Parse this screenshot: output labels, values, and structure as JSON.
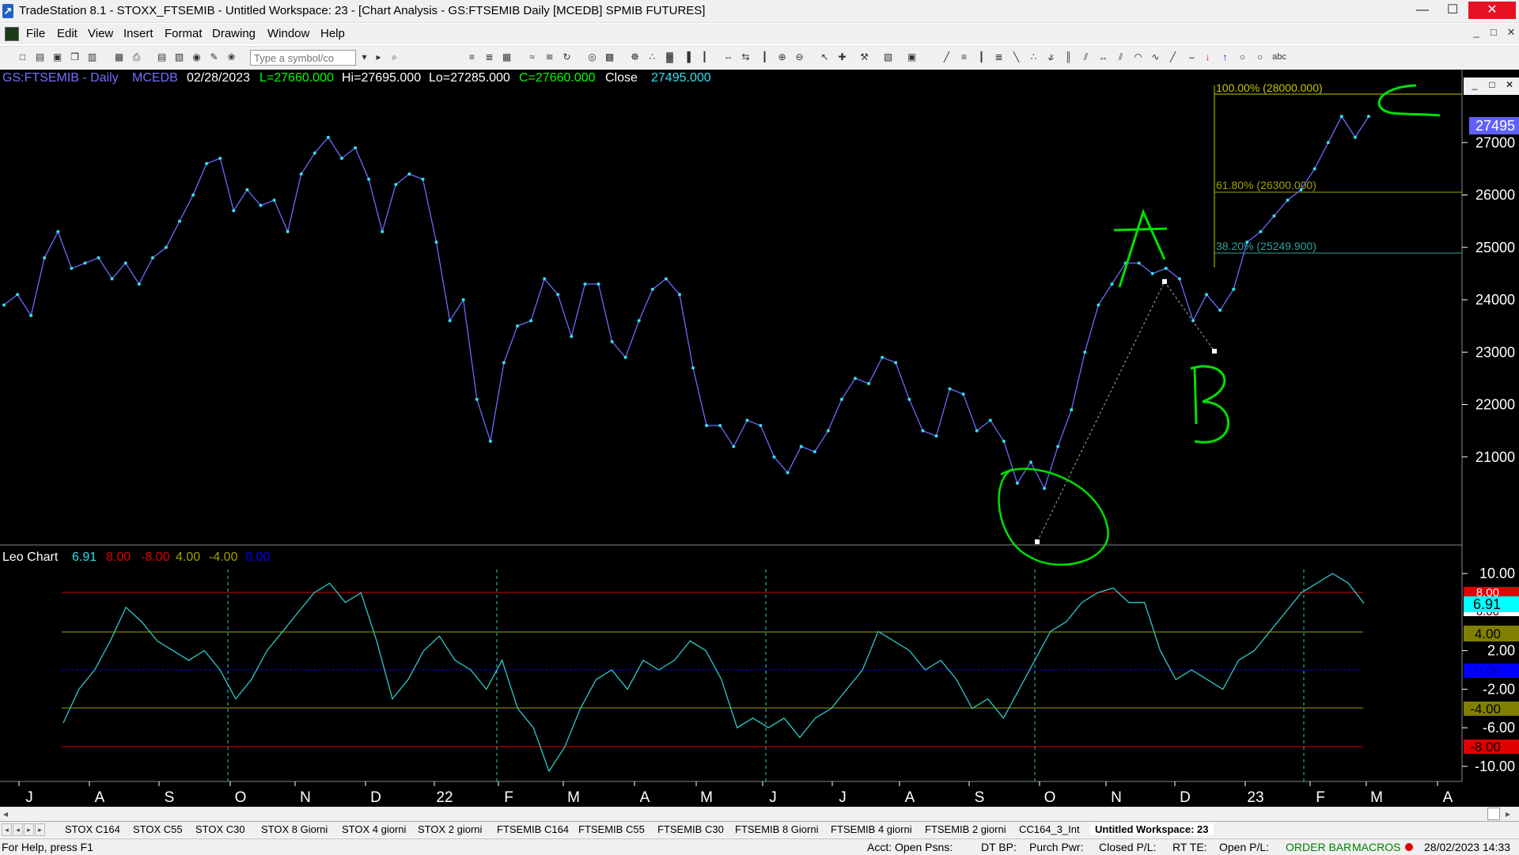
{
  "window": {
    "title": "TradeStation 8.1 - STOXX_FTSEMIB - Untitled Workspace:  23 - [Chart Analysis - GS:FTSEMIB  Daily  [MCEDB] SPMIB FUTURES]",
    "minimize": "—",
    "maximize": "☐",
    "close": "✕"
  },
  "menu": {
    "items": [
      "File",
      "Edit",
      "View",
      "Insert",
      "Format",
      "Drawing",
      "Window",
      "Help"
    ],
    "mdi": [
      "_",
      "□",
      "✕"
    ]
  },
  "toolbar": {
    "symbol_placeholder": "Type a symbol/co"
  },
  "chart_header": {
    "symbol": "GS:FTSEMIB - Daily",
    "source": "MCEDB",
    "date": "02/28/2023",
    "low": "L=27660.000",
    "high": "Hi=27695.000",
    "lo": "Lo=27285.000",
    "close": "C=27660.000",
    "close_label": "Close",
    "close_value": "27495.000"
  },
  "price_axis": {
    "ticks": [
      "27000",
      "26000",
      "25000",
      "24000",
      "23000",
      "22000",
      "21000"
    ],
    "current": "27495"
  },
  "fib": {
    "l100": "100.00% (28000.000)",
    "l618": "61.80% (26300.000)",
    "l382": "38.20% (25249.900)"
  },
  "annotations": {
    "a": "A",
    "b": "B",
    "c": "C"
  },
  "indicator": {
    "name": "Leo Chart",
    "v1": "6.91",
    "v2": "8.00",
    "v3": "-8.00",
    "v4": "4.00",
    "v5": "-4.00",
    "v6": "0.00",
    "axis": [
      "10.00",
      "2.00",
      "-2.00",
      "-6.00",
      "-10.00"
    ],
    "boxes": [
      "8.00",
      "6.91",
      "6.00",
      "4.00",
      "0.00",
      "-4.00",
      "-8.00"
    ]
  },
  "time_axis": [
    "J",
    "A",
    "S",
    "O",
    "N",
    "D",
    "22",
    "F",
    "M",
    "A",
    "M",
    "J",
    "J",
    "A",
    "S",
    "O",
    "N",
    "D",
    "23",
    "F",
    "M",
    "A"
  ],
  "tabs": [
    "STOX C164",
    "STOX C55",
    "STOX  C30",
    "STOX  8 Giorni",
    "STOX 4 giorni",
    "STOX  2 giorni",
    "FTSEMIB C164",
    "FTSEMIB C55",
    "FTSEMIB C30",
    "FTSEMIB  8 Giorni",
    "FTSEMIB  4 giorni",
    "FTSEMIB  2 giorni",
    "CC164_3_Int",
    "Untitled Workspace:  23"
  ],
  "status": {
    "help": "For Help, press F1",
    "acct": "Acct:",
    "open_psns": "Open Psns:",
    "dt_bp": "DT BP:",
    "purch_pwr": "Purch Pwr:",
    "closed_pl": "Closed P/L:",
    "rt_te": "RT TE:",
    "open_pl": "Open P/L:",
    "order_bar": "ORDER BAR",
    "macros": "MACROS",
    "datetime": "28/02/2023 14:33"
  },
  "colors": {
    "price_line": "#6a6aff",
    "price_dot": "#30e0f0",
    "indicator_line": "#30c8c8",
    "level_red": "#e00000",
    "level_olive": "#a0a000",
    "level_blue": "#0000ff",
    "annotation": "#00e000",
    "fib_100": "#c8c800",
    "fib_618": "#a0a000",
    "fib_382": "#30a0a0"
  },
  "chart_data": [
    {
      "type": "line",
      "title": "GS:FTSEMIB - Daily",
      "x_labels": [
        "J",
        "A",
        "S",
        "O",
        "N",
        "D",
        "22",
        "F",
        "M",
        "A",
        "M",
        "J",
        "J",
        "A",
        "S",
        "O",
        "N",
        "D",
        "23",
        "F"
      ],
      "y": [
        23900,
        24100,
        23700,
        24800,
        25300,
        24600,
        24700,
        24800,
        24400,
        24700,
        24300,
        24800,
        25000,
        25500,
        26000,
        26600,
        26700,
        25700,
        26100,
        25800,
        25900,
        25300,
        26400,
        26800,
        27100,
        26700,
        26900,
        26300,
        25300,
        26200,
        26400,
        26300,
        25100,
        23600,
        24000,
        22100,
        21300,
        22800,
        23500,
        23600,
        24400,
        24100,
        23300,
        24300,
        24300,
        23200,
        22900,
        23600,
        24200,
        24400,
        24100,
        22700,
        21600,
        21600,
        21200,
        21700,
        21600,
        21000,
        20700,
        21200,
        21100,
        21500,
        22100,
        22500,
        22400,
        22900,
        22800,
        22100,
        21500,
        21400,
        22300,
        22200,
        21500,
        21700,
        21300,
        20500,
        20900,
        20400,
        21200,
        21900,
        23000,
        23900,
        24300,
        24700,
        24700,
        24500,
        24600,
        24400,
        23600,
        24100,
        23800,
        24200,
        25100,
        25300,
        25600,
        25900,
        26100,
        26500,
        27000,
        27500,
        27100,
        27500
      ],
      "ylim": [
        20000,
        28000
      ]
    },
    {
      "type": "line",
      "title": "Leo Chart",
      "y": [
        -5.5,
        -2,
        0,
        3,
        6.5,
        5,
        3,
        2,
        1,
        2,
        0,
        -3,
        -1,
        2,
        4,
        6,
        8,
        9,
        7,
        8,
        3,
        -3,
        -1,
        2,
        3.5,
        1,
        0,
        -2,
        1,
        -4,
        -6,
        -10.5,
        -8,
        -4,
        -1,
        0,
        -2,
        1,
        0,
        1,
        3,
        2,
        -1,
        -6,
        -5,
        -6,
        -5,
        -7,
        -5,
        -4,
        -2,
        0,
        4,
        3,
        2,
        0,
        1,
        -1,
        -4,
        -3,
        -5,
        -2,
        1,
        4,
        5,
        7,
        8,
        8.5,
        7,
        7,
        2,
        -1,
        0,
        -1,
        -2,
        1,
        2,
        4,
        6,
        8,
        9,
        10,
        9,
        6.91
      ],
      "ylim": [
        -10,
        10
      ]
    }
  ]
}
